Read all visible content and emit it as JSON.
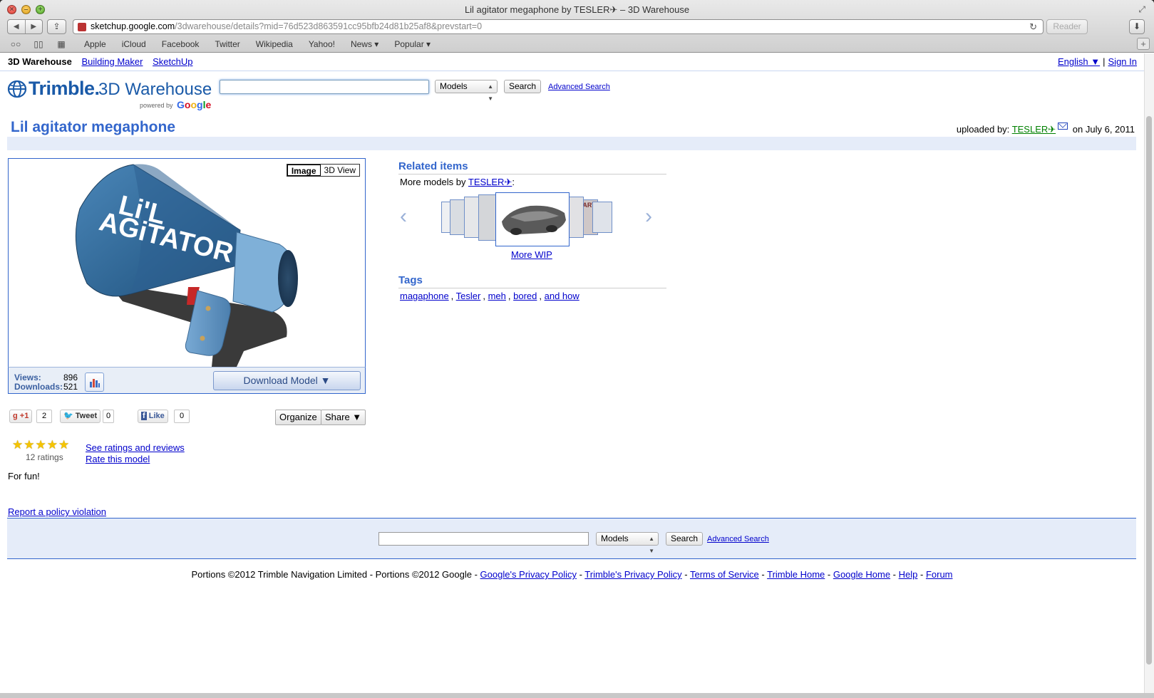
{
  "browser": {
    "window_title": "Lil agitator megaphone by TESLER✈ – 3D Warehouse",
    "url_host": "sketchup.google.com",
    "url_path": "/3dwarehouse/details?mid=76d523d863591cc95bfb24d81b25af8&prevstart=0",
    "reader_label": "Reader",
    "bookmarks": [
      "Apple",
      "iCloud",
      "Facebook",
      "Twitter",
      "Wikipedia",
      "Yahoo!",
      "News ▾",
      "Popular ▾"
    ]
  },
  "topnav": {
    "brand": "3D Warehouse",
    "links": [
      "Building Maker",
      "SketchUp"
    ],
    "language": "English ▼",
    "signin": "Sign In"
  },
  "logo": {
    "trimble": "Trimble.",
    "warehouse": "3D Warehouse",
    "powered_by": "powered by",
    "google": "Google"
  },
  "search": {
    "value": "",
    "category": "Models",
    "button": "Search",
    "advanced": "Advanced Search"
  },
  "model": {
    "title": "Lil agitator megaphone",
    "uploaded_by_label": "uploaded by:",
    "uploader": "TESLER✈",
    "upload_date": "on July 6, 2011",
    "image_tab": "Image",
    "view3d_tab": "3D View",
    "megaphone_text_1": "Li'L",
    "megaphone_text_2": "AGiTATOR",
    "views_label": "Views:",
    "views": "896",
    "downloads_label": "Downloads:",
    "downloads": "521",
    "download_button": "Download Model ▼",
    "description": "For fun!",
    "rating_stars": 5,
    "ratings_count": "12 ratings",
    "see_ratings": "See ratings and reviews",
    "rate_model": "Rate this model",
    "report": "Report a policy violation"
  },
  "social": {
    "gplus": "+1",
    "gplus_count": "2",
    "tweet": "Tweet",
    "tweet_count": "0",
    "like": "Like",
    "like_count": "0",
    "organize": "Organize",
    "share": "Share ▼"
  },
  "related": {
    "heading": "Related items",
    "more_by_label": "More models by",
    "more_by_user": "TESLER✈",
    "more_by_colon": ":",
    "featured": "More WIP",
    "thumb_text": "ARY"
  },
  "tags": {
    "heading": "Tags",
    "items": [
      "magaphone",
      "Tesler",
      "meh",
      "bored",
      "and how"
    ]
  },
  "footer": {
    "search_category": "Models",
    "search_button": "Search",
    "advanced": "Advanced Search",
    "copyright": "Portions ©2012 Trimble Navigation Limited - Portions ©2012 Google -",
    "links": [
      "Google's Privacy Policy",
      "Trimble's Privacy Policy",
      "Terms of Service",
      "Trimble Home",
      "Google Home",
      "Help",
      "Forum"
    ]
  },
  "colors": {
    "accent": "#3366cc",
    "uploader": "#008000",
    "strip": "#e5ecf9",
    "star": "#f5c400"
  }
}
